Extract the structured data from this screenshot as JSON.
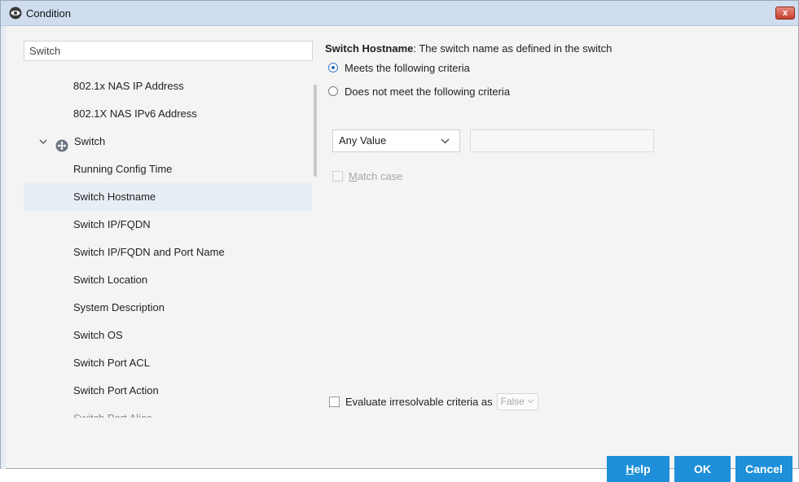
{
  "window": {
    "title": "Condition",
    "close_label": "x"
  },
  "search": {
    "value": "Switch"
  },
  "tree": {
    "items": [
      {
        "label": "802.1x NAS IP Address"
      },
      {
        "label": "802.1X NAS IPv6 Address"
      },
      {
        "label": "Switch",
        "group": true,
        "expanded": true
      },
      {
        "label": "Running Config Time"
      },
      {
        "label": "Switch Hostname",
        "selected": true
      },
      {
        "label": "Switch IP/FQDN"
      },
      {
        "label": "Switch IP/FQDN and Port Name"
      },
      {
        "label": "Switch Location"
      },
      {
        "label": "System Description"
      },
      {
        "label": "Switch OS"
      },
      {
        "label": "Switch Port ACL"
      },
      {
        "label": "Switch Port Action"
      },
      {
        "label": "Switch Port Alias"
      }
    ]
  },
  "detail": {
    "field_name": "Switch Hostname",
    "field_description": ": The switch name as defined in the switch",
    "radio_meets": "Meets the following criteria",
    "radio_not_meets": "Does not meet the following criteria",
    "operator_value": "Any Value",
    "match_case_label": "atch case",
    "match_case_mnemonic": "M",
    "evaluate_label": "Evaluate irresolvable criteria as",
    "evaluate_value": "False"
  },
  "buttons": {
    "help_mnemonic": "H",
    "help_rest": "elp",
    "ok": "OK",
    "cancel": "Cancel"
  },
  "colors": {
    "accent": "#1e8fd8",
    "titlebar": "#cfddef",
    "selected_row": "#e8eef5"
  }
}
